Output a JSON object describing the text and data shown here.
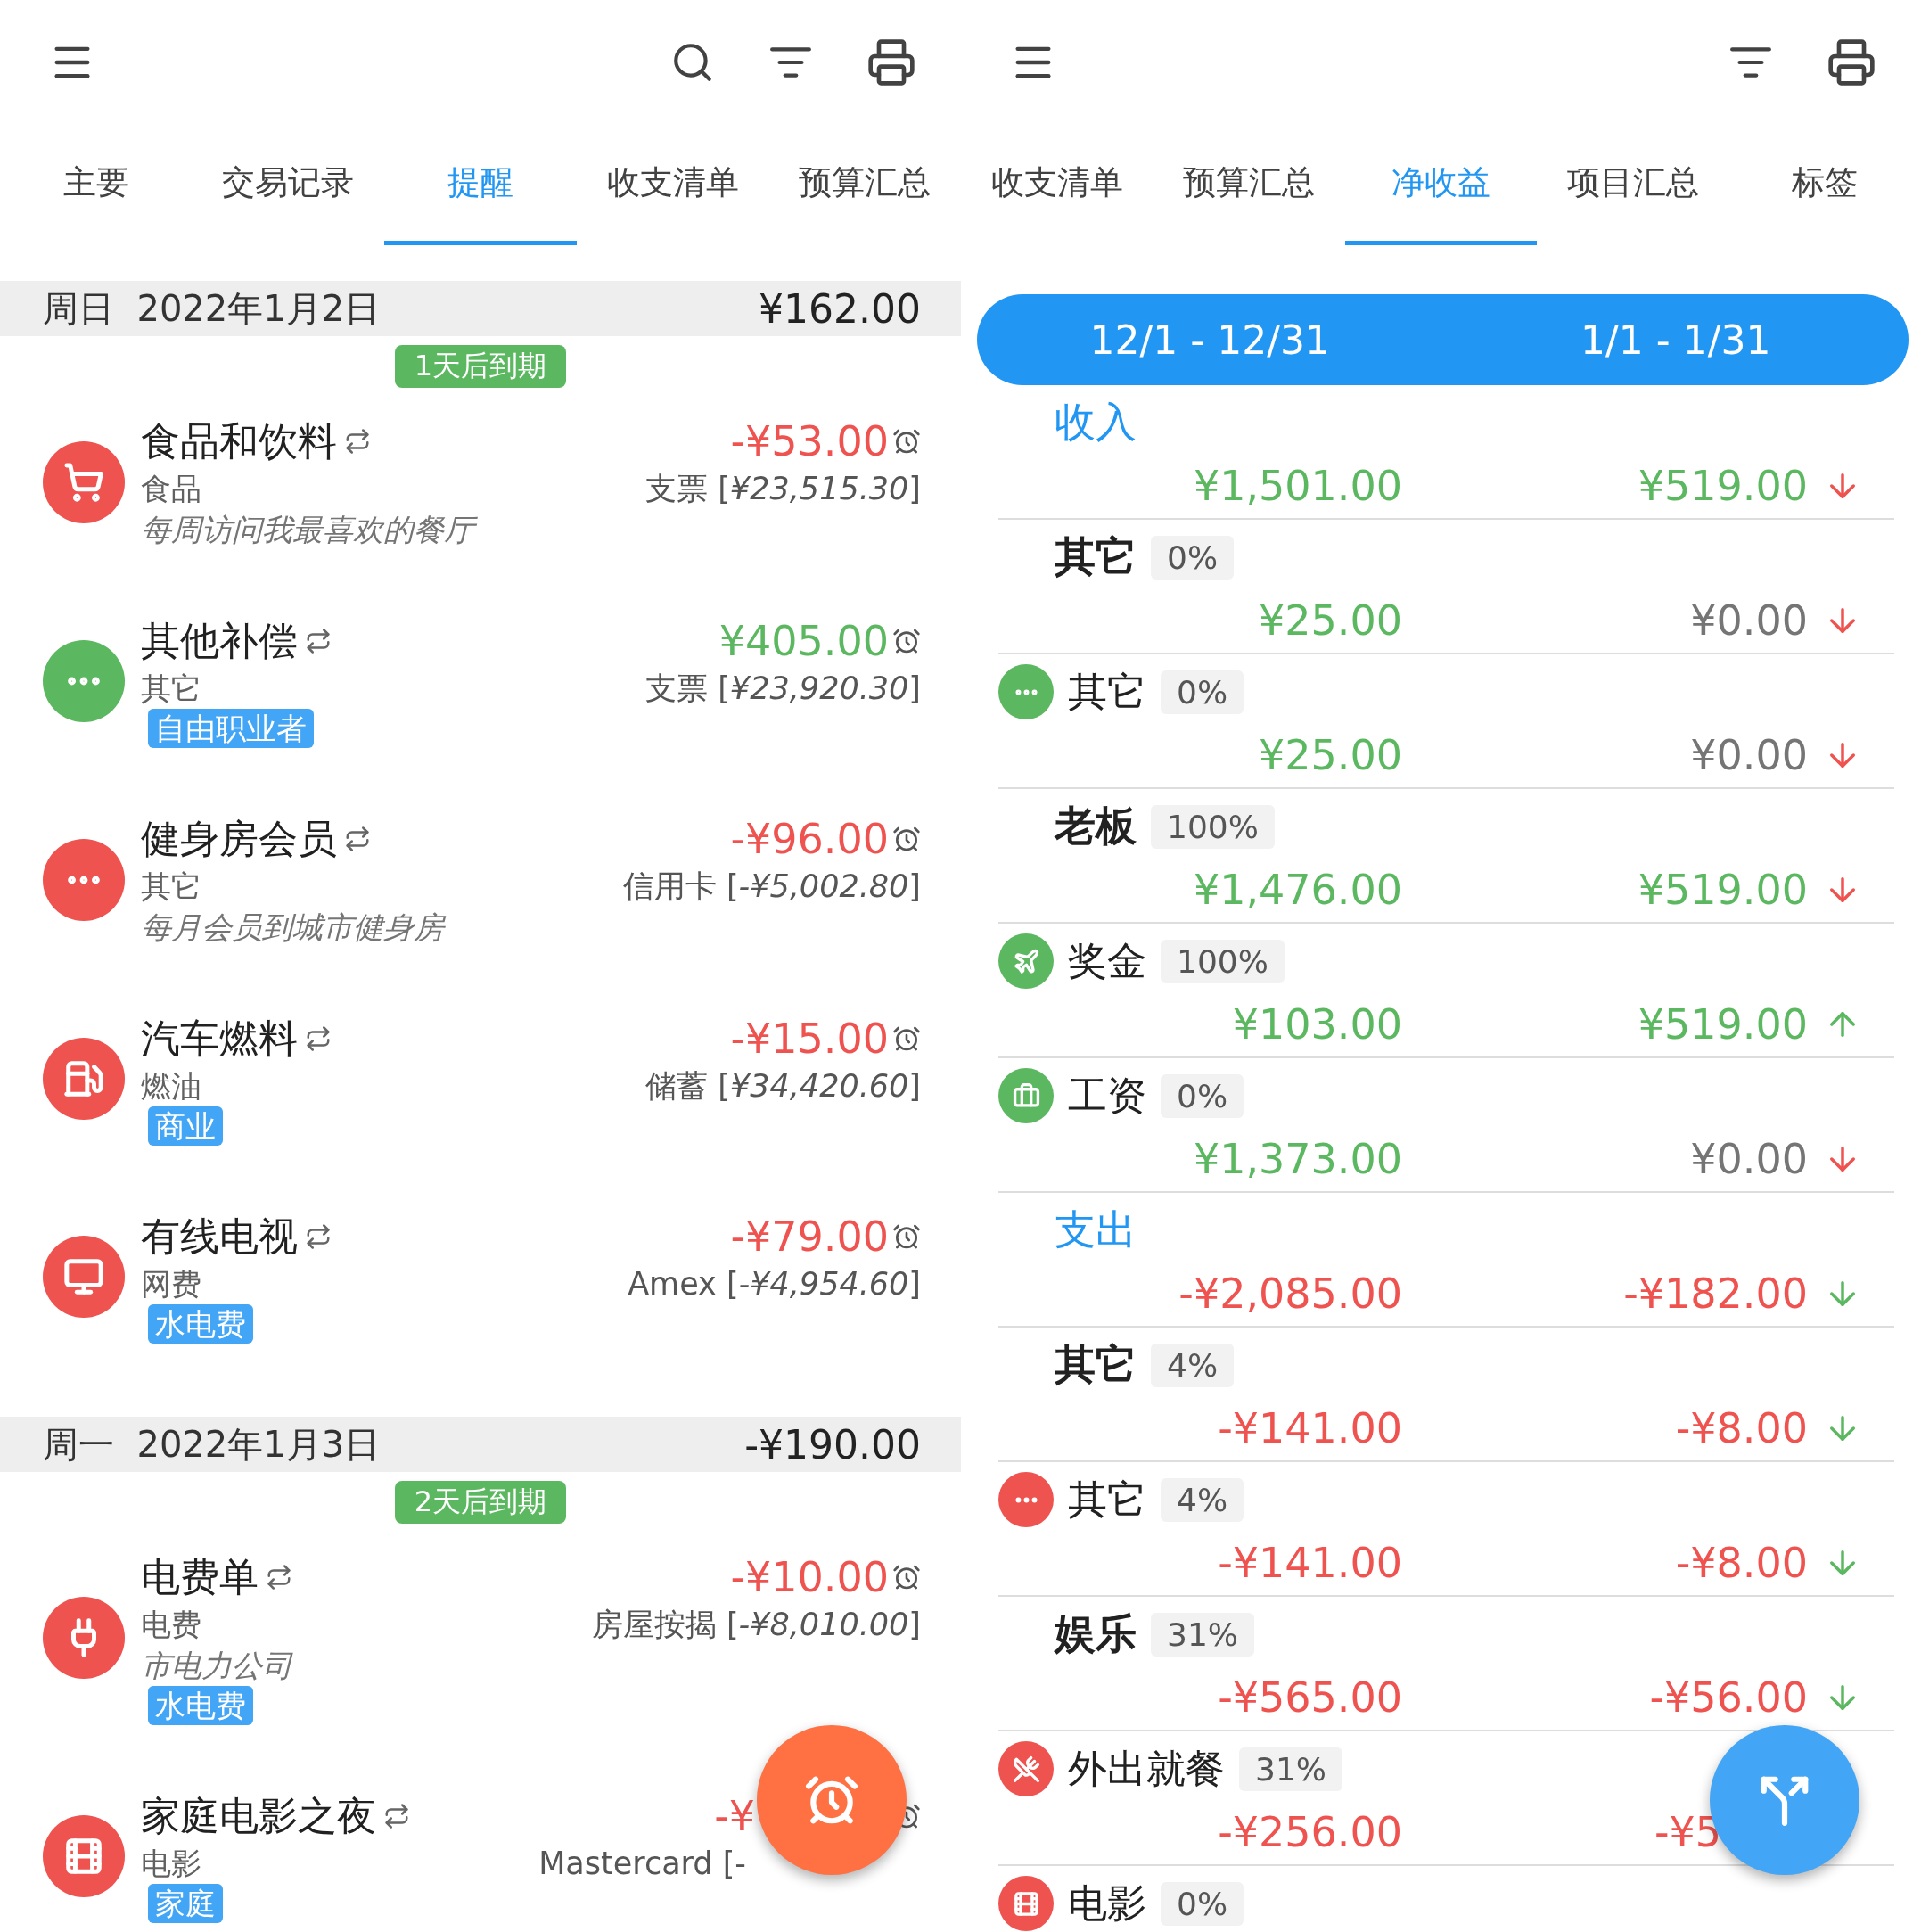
{
  "left": {
    "tabs": [
      {
        "label": "主要",
        "selected": false
      },
      {
        "label": "交易记录",
        "selected": false
      },
      {
        "label": "提醒",
        "selected": true
      },
      {
        "label": "收支清单",
        "selected": false
      },
      {
        "label": "预算汇总",
        "selected": false
      }
    ],
    "days": [
      {
        "weekday": "周日",
        "date": "2022年1月2日",
        "total": "¥162.00",
        "due": "1天后到期",
        "items": [
          {
            "title": "食品和饮料",
            "category": "食品",
            "note": "每周访问我最喜欢的餐厅",
            "color": "#ef5350",
            "amount": "-¥53.00",
            "positive": false,
            "account": "支票 [*¥23,515.30*]"
          },
          {
            "title": "其他补偿",
            "category": "其它",
            "tag": "自由职业者",
            "color": "#5cb860",
            "amount": "¥405.00",
            "positive": true,
            "account": "支票 [*¥23,920.30*]"
          },
          {
            "title": "健身房会员",
            "category": "其它",
            "note": "每月会员到城市健身房",
            "color": "#ef5350",
            "amount": "-¥96.00",
            "positive": false,
            "account": "信用卡 [*-¥5,002.80*]"
          },
          {
            "title": "汽车燃料",
            "category": "燃油",
            "tag": "商业",
            "color": "#ef5350",
            "amount": "-¥15.00",
            "positive": false,
            "account": "储蓄 [*¥34,420.60*]"
          },
          {
            "title": "有线电视",
            "category": "网费",
            "tag": "水电费",
            "color": "#ef5350",
            "amount": "-¥79.00",
            "positive": false,
            "account": "Amex [*-¥4,954.60*]"
          }
        ]
      },
      {
        "weekday": "周一",
        "date": "2022年1月3日",
        "total": "-¥190.00",
        "due": "2天后到期",
        "items": [
          {
            "title": "电费单",
            "category": "电费",
            "note": "市电力公司",
            "tag": "水电费",
            "color": "#ef5350",
            "amount": "-¥10.00",
            "positive": false,
            "account": "房屋按揭 [*-¥8,010.00*]"
          },
          {
            "title": "家庭电影之夜",
            "category": "电影",
            "tag": "家庭",
            "color": "#ef5350",
            "amount": "-¥",
            "positive": false,
            "account": "Mastercard [-",
            "cut": true
          }
        ]
      }
    ]
  },
  "right": {
    "tabs": [
      {
        "label": "收支清单",
        "selected": false
      },
      {
        "label": "预算汇总",
        "selected": false
      },
      {
        "label": "净收益",
        "selected": true
      },
      {
        "label": "项目汇总",
        "selected": false
      },
      {
        "label": "标签",
        "selected": false
      }
    ],
    "periods": [
      "12/1 - 12/31",
      "1/1 - 1/31"
    ],
    "rows": [
      {
        "kind": "section",
        "name": "收入",
        "values": [
          {
            "text": "¥1,501.00",
            "color": "#5cb860"
          },
          {
            "text": "¥519.00",
            "color": "#5cb860"
          }
        ],
        "trend": {
          "up": false,
          "color": "#ef5350"
        }
      },
      {
        "kind": "group",
        "name": "其它",
        "percent": "0%",
        "values": [
          {
            "text": "¥25.00",
            "color": "#5cb860"
          },
          {
            "text": "¥0.00",
            "color": "#757575"
          }
        ],
        "trend": {
          "up": false,
          "color": "#ef5350"
        }
      },
      {
        "kind": "category",
        "color": "#5cb860",
        "name": "其它",
        "percent": "0%",
        "values": [
          {
            "text": "¥25.00",
            "color": "#5cb860"
          },
          {
            "text": "¥0.00",
            "color": "#757575"
          }
        ],
        "trend": {
          "up": false,
          "color": "#ef5350"
        }
      },
      {
        "kind": "group",
        "name": "老板",
        "percent": "100%",
        "values": [
          {
            "text": "¥1,476.00",
            "color": "#5cb860"
          },
          {
            "text": "¥519.00",
            "color": "#5cb860"
          }
        ],
        "trend": {
          "up": false,
          "color": "#ef5350"
        }
      },
      {
        "kind": "category",
        "color": "#5cb860",
        "name": "奖金",
        "percent": "100%",
        "values": [
          {
            "text": "¥103.00",
            "color": "#5cb860"
          },
          {
            "text": "¥519.00",
            "color": "#5cb860"
          }
        ],
        "trend": {
          "up": true,
          "color": "#5cb860"
        }
      },
      {
        "kind": "category",
        "color": "#5cb860",
        "name": "工资",
        "percent": "0%",
        "values": [
          {
            "text": "¥1,373.00",
            "color": "#5cb860"
          },
          {
            "text": "¥0.00",
            "color": "#757575"
          }
        ],
        "trend": {
          "up": false,
          "color": "#ef5350"
        }
      },
      {
        "kind": "section",
        "name": "支出",
        "values": [
          {
            "text": "-¥2,085.00",
            "color": "#ef5350"
          },
          {
            "text": "-¥182.00",
            "color": "#ef5350"
          }
        ],
        "trend": {
          "up": false,
          "color": "#5cb860"
        }
      },
      {
        "kind": "group",
        "name": "其它",
        "percent": "4%",
        "values": [
          {
            "text": "-¥141.00",
            "color": "#ef5350"
          },
          {
            "text": "-¥8.00",
            "color": "#ef5350"
          }
        ],
        "trend": {
          "up": false,
          "color": "#5cb860"
        }
      },
      {
        "kind": "category",
        "color": "#ef5350",
        "name": "其它",
        "percent": "4%",
        "values": [
          {
            "text": "-¥141.00",
            "color": "#ef5350"
          },
          {
            "text": "-¥8.00",
            "color": "#ef5350"
          }
        ],
        "trend": {
          "up": false,
          "color": "#5cb860"
        }
      },
      {
        "kind": "group",
        "name": "娱乐",
        "percent": "31%",
        "values": [
          {
            "text": "-¥565.00",
            "color": "#ef5350"
          },
          {
            "text": "-¥56.00",
            "color": "#ef5350"
          }
        ],
        "trend": {
          "up": false,
          "color": "#5cb860"
        }
      },
      {
        "kind": "category",
        "color": "#ef5350",
        "name": "外出就餐",
        "percent": "31%",
        "values": [
          {
            "text": "-¥256.00",
            "color": "#ef5350"
          },
          {
            "text": "-¥5",
            "color": "#ef5350",
            "cut": true
          }
        ]
      },
      {
        "kind": "category",
        "color": "#ef5350",
        "name": "电影",
        "percent": "0%"
      }
    ]
  }
}
